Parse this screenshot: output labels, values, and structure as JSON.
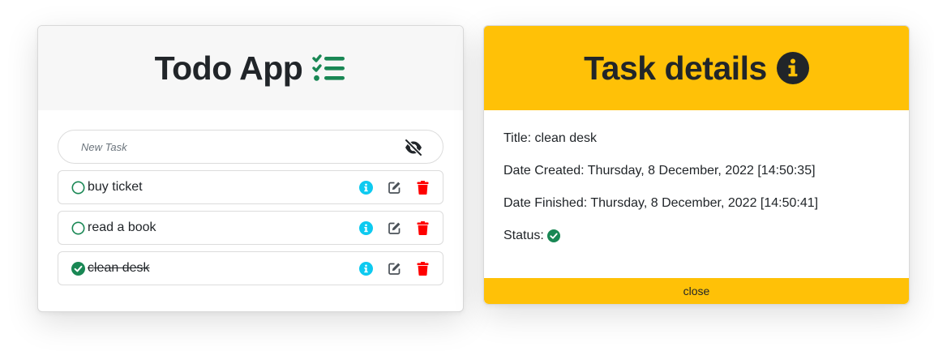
{
  "todo": {
    "title": "Todo App",
    "new_task_placeholder": "New Task",
    "tasks": [
      {
        "label": "buy ticket",
        "done": false
      },
      {
        "label": "read a book",
        "done": false
      },
      {
        "label": "clean desk",
        "done": true
      }
    ]
  },
  "details": {
    "title": "Task details",
    "title_line": "Title: clean desk",
    "created_line": "Date Created: Thursday, 8 December, 2022 [14:50:35]",
    "finished_line": "Date Finished: Thursday, 8 December, 2022 [14:50:41]",
    "status_label": "Status:",
    "close_label": "close"
  },
  "colors": {
    "accent_yellow": "#ffc107",
    "success_green": "#198754",
    "info_cyan": "#0dcaf0",
    "danger_red": "#ff0000",
    "muted_gray": "#6c757d"
  },
  "icons": {
    "header_todo": "list-check-icon",
    "header_details": "info-circle-icon",
    "visibility": "eye-slash-icon",
    "task_info": "info-circle-icon",
    "task_edit": "edit-icon",
    "task_delete": "trash-icon",
    "status_done": "check-circle-icon",
    "status_open": "circle-icon"
  }
}
